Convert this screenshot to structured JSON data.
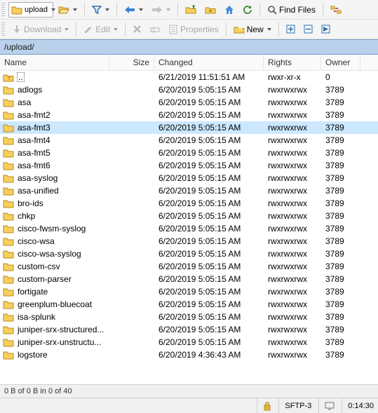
{
  "toolbar1": {
    "address": "upload",
    "find_files": "Find Files"
  },
  "toolbar2": {
    "download": "Download",
    "edit": "Edit",
    "properties": "Properties",
    "new": "New"
  },
  "path": "/upload/",
  "headers": {
    "name": "Name",
    "size": "Size",
    "changed": "Changed",
    "rights": "Rights",
    "owner": "Owner"
  },
  "files": [
    {
      "type": "up",
      "name": "..",
      "changed": "6/21/2019 11:51:51 AM",
      "rights": "rwxr-xr-x",
      "owner": "0",
      "selected": false
    },
    {
      "name": "adlogs",
      "changed": "6/20/2019 5:05:15 AM",
      "rights": "rwxrwxrwx",
      "owner": "3789"
    },
    {
      "name": "asa",
      "changed": "6/20/2019 5:05:15 AM",
      "rights": "rwxrwxrwx",
      "owner": "3789"
    },
    {
      "name": "asa-fmt2",
      "changed": "6/20/2019 5:05:15 AM",
      "rights": "rwxrwxrwx",
      "owner": "3789"
    },
    {
      "name": "asa-fmt3",
      "changed": "6/20/2019 5:05:15 AM",
      "rights": "rwxrwxrwx",
      "owner": "3789",
      "selected": true
    },
    {
      "name": "asa-fmt4",
      "changed": "6/20/2019 5:05:15 AM",
      "rights": "rwxrwxrwx",
      "owner": "3789"
    },
    {
      "name": "asa-fmt5",
      "changed": "6/20/2019 5:05:15 AM",
      "rights": "rwxrwxrwx",
      "owner": "3789"
    },
    {
      "name": "asa-fmt6",
      "changed": "6/20/2019 5:05:15 AM",
      "rights": "rwxrwxrwx",
      "owner": "3789"
    },
    {
      "name": "asa-syslog",
      "changed": "6/20/2019 5:05:15 AM",
      "rights": "rwxrwxrwx",
      "owner": "3789"
    },
    {
      "name": "asa-unified",
      "changed": "6/20/2019 5:05:15 AM",
      "rights": "rwxrwxrwx",
      "owner": "3789"
    },
    {
      "name": "bro-ids",
      "changed": "6/20/2019 5:05:15 AM",
      "rights": "rwxrwxrwx",
      "owner": "3789"
    },
    {
      "name": "chkp",
      "changed": "6/20/2019 5:05:15 AM",
      "rights": "rwxrwxrwx",
      "owner": "3789"
    },
    {
      "name": "cisco-fwsm-syslog",
      "changed": "6/20/2019 5:05:15 AM",
      "rights": "rwxrwxrwx",
      "owner": "3789"
    },
    {
      "name": "cisco-wsa",
      "changed": "6/20/2019 5:05:15 AM",
      "rights": "rwxrwxrwx",
      "owner": "3789"
    },
    {
      "name": "cisco-wsa-syslog",
      "changed": "6/20/2019 5:05:15 AM",
      "rights": "rwxrwxrwx",
      "owner": "3789"
    },
    {
      "name": "custom-csv",
      "changed": "6/20/2019 5:05:15 AM",
      "rights": "rwxrwxrwx",
      "owner": "3789"
    },
    {
      "name": "custom-parser",
      "changed": "6/20/2019 5:05:15 AM",
      "rights": "rwxrwxrwx",
      "owner": "3789"
    },
    {
      "name": "fortigate",
      "changed": "6/20/2019 5:05:15 AM",
      "rights": "rwxrwxrwx",
      "owner": "3789"
    },
    {
      "name": "greenplum-bluecoat",
      "changed": "6/20/2019 5:05:15 AM",
      "rights": "rwxrwxrwx",
      "owner": "3789"
    },
    {
      "name": "isa-splunk",
      "changed": "6/20/2019 5:05:15 AM",
      "rights": "rwxrwxrwx",
      "owner": "3789"
    },
    {
      "name": "juniper-srx-structured...",
      "changed": "6/20/2019 5:05:15 AM",
      "rights": "rwxrwxrwx",
      "owner": "3789"
    },
    {
      "name": "juniper-srx-unstructu...",
      "changed": "6/20/2019 5:05:15 AM",
      "rights": "rwxrwxrwx",
      "owner": "3789"
    },
    {
      "name": "logstore",
      "changed": "6/20/2019 4:36:43 AM",
      "rights": "rwxrwxrwx",
      "owner": "3789"
    }
  ],
  "status": {
    "selection": "0 B of 0 B in 0 of 40",
    "protocol": "SFTP-3",
    "elapsed": "0:14:30"
  }
}
